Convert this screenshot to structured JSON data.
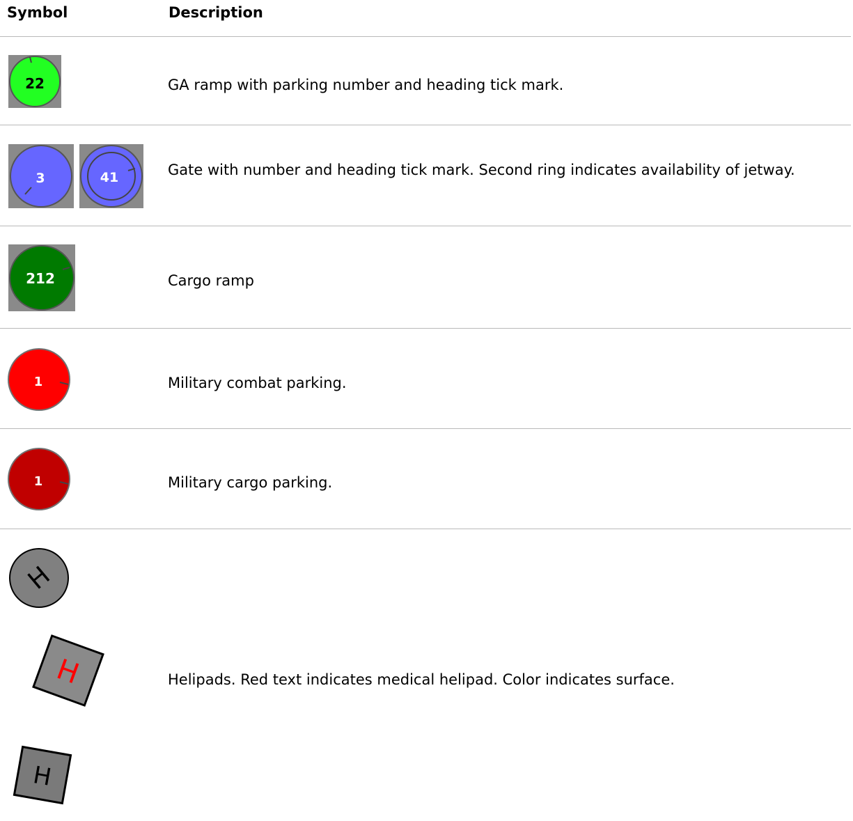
{
  "table": {
    "headers": {
      "symbol": "Symbol",
      "description": "Description"
    },
    "rows": [
      {
        "description": "GA ramp with parking number and heading tick mark.",
        "symbols": [
          {
            "icon": "ga-ramp-icon",
            "label": "22",
            "color": "#22ff22"
          }
        ]
      },
      {
        "description": "Gate with number and heading tick mark. Second ring indicates availability of jetway.",
        "symbols": [
          {
            "icon": "gate-icon",
            "label": "3",
            "color": "#6666ff"
          },
          {
            "icon": "gate-jetway-icon",
            "label": "41",
            "color": "#6666ff"
          }
        ]
      },
      {
        "description": "Cargo ramp",
        "symbols": [
          {
            "icon": "cargo-ramp-icon",
            "label": "212",
            "color": "#007a00"
          }
        ]
      },
      {
        "description": "Military combat parking.",
        "symbols": [
          {
            "icon": "military-combat-icon",
            "label": "1",
            "color": "#ff0000"
          }
        ]
      },
      {
        "description": "Military cargo parking.",
        "symbols": [
          {
            "icon": "military-cargo-icon",
            "label": "1",
            "color": "#c00000"
          }
        ]
      },
      {
        "description": "Helipads. Red text indicates medical helipad. Color indicates surface.",
        "symbols": [
          {
            "icon": "helipad-round-icon",
            "label": "H",
            "color": "#808080"
          },
          {
            "icon": "helipad-medical-icon",
            "label": "H",
            "color": "#ff0000"
          },
          {
            "icon": "helipad-square-icon",
            "label": "H",
            "color": "#7a7a7a"
          }
        ]
      }
    ]
  }
}
